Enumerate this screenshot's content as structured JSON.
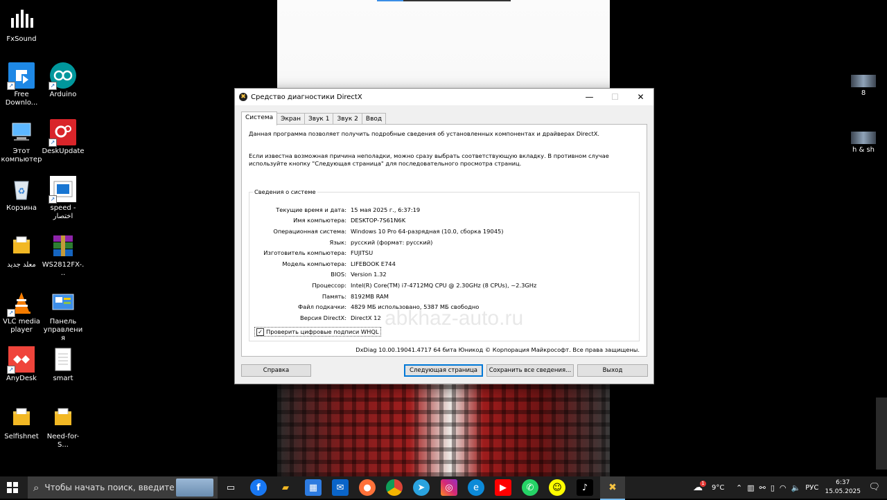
{
  "desktop": {
    "icons": [
      {
        "label": "FxSound"
      },
      {
        "label": "Free Downlo..."
      },
      {
        "label": "Arduino"
      },
      {
        "label": "Этот компьютер"
      },
      {
        "label": "DeskUpdate"
      },
      {
        "label": "Корзина"
      },
      {
        "label": "speed - اختصار"
      },
      {
        "label": "معلد جديد"
      },
      {
        "label": "WS2812FX-..."
      },
      {
        "label": "VLC media player"
      },
      {
        "label": "Панель управления"
      },
      {
        "label": "AnyDesk"
      },
      {
        "label": "smart"
      },
      {
        "label": "Selfishnet"
      },
      {
        "label": "Need-for-S..."
      }
    ],
    "right_items": [
      {
        "label": "8"
      },
      {
        "label": "h & sh"
      }
    ]
  },
  "window": {
    "title": "Средство диагностики DirectX",
    "controls": {
      "minimize": "—",
      "maximize": "☐",
      "close": "✕"
    },
    "tabs": [
      {
        "label": "Система",
        "active": true
      },
      {
        "label": "Экран"
      },
      {
        "label": "Звук 1"
      },
      {
        "label": "Звук 2"
      },
      {
        "label": "Ввод"
      }
    ],
    "intro1": "Данная программа позволяет получить подробные сведения об установленных компонентах и драйверах DirectX.",
    "intro2": "Если известна возможная причина неполадки, можно сразу выбрать соответствующую вкладку. В противном случае используйте кнопку \"Следующая страница\" для последовательного просмотра страниц.",
    "group_title": "Сведения о системе",
    "rows": [
      {
        "key": "Текущие время и дата:",
        "value": "15 мая 2025 г., 6:37:19"
      },
      {
        "key": "Имя компьютера:",
        "value": "DESKTOP-7S61N6K"
      },
      {
        "key": "Операционная система:",
        "value": "Windows 10 Pro 64-разрядная (10.0, сборка 19045)"
      },
      {
        "key": "Язык:",
        "value": "русский (формат: русский)"
      },
      {
        "key": "Изготовитель компьютера:",
        "value": "FUJITSU"
      },
      {
        "key": "Модель компьютера:",
        "value": "LIFEBOOK E744"
      },
      {
        "key": "BIOS:",
        "value": "Version 1.32"
      },
      {
        "key": "Процессор:",
        "value": "Intel(R) Core(TM) i7-4712MQ CPU @ 2.30GHz (8 CPUs), ~2.3GHz"
      },
      {
        "key": "Память:",
        "value": "8192MB RAM"
      },
      {
        "key": "Файл подкачки:",
        "value": "4829 МБ использовано, 5387 МБ свободно"
      },
      {
        "key": "Версия DirectX:",
        "value": "DirectX 12"
      }
    ],
    "whql_label": "Проверить цифровые подписи WHQL",
    "whql_checked": true,
    "watermark": "abkhaz-auto.ru",
    "copyright": "DxDiag 10.00.19041.4717 64 бита Юникод © Корпорация Майкрософт. Все права защищены.",
    "buttons": {
      "help": "Справка",
      "next": "Следующая страница",
      "save": "Сохранить все сведения...",
      "exit": "Выход"
    }
  },
  "taskbar": {
    "search_placeholder": "Чтобы начать поиск, введите",
    "pinned": [
      "task-view",
      "facebook",
      "file-explorer",
      "store",
      "mail",
      "firefox",
      "chrome",
      "telegram",
      "instagram",
      "edge",
      "youtube",
      "whatsapp",
      "snapchat",
      "tiktok",
      "directx"
    ],
    "weather": "9°C",
    "weather_badge": "1",
    "language": "РУС",
    "time": "6:37",
    "date": "15.05.2025"
  }
}
